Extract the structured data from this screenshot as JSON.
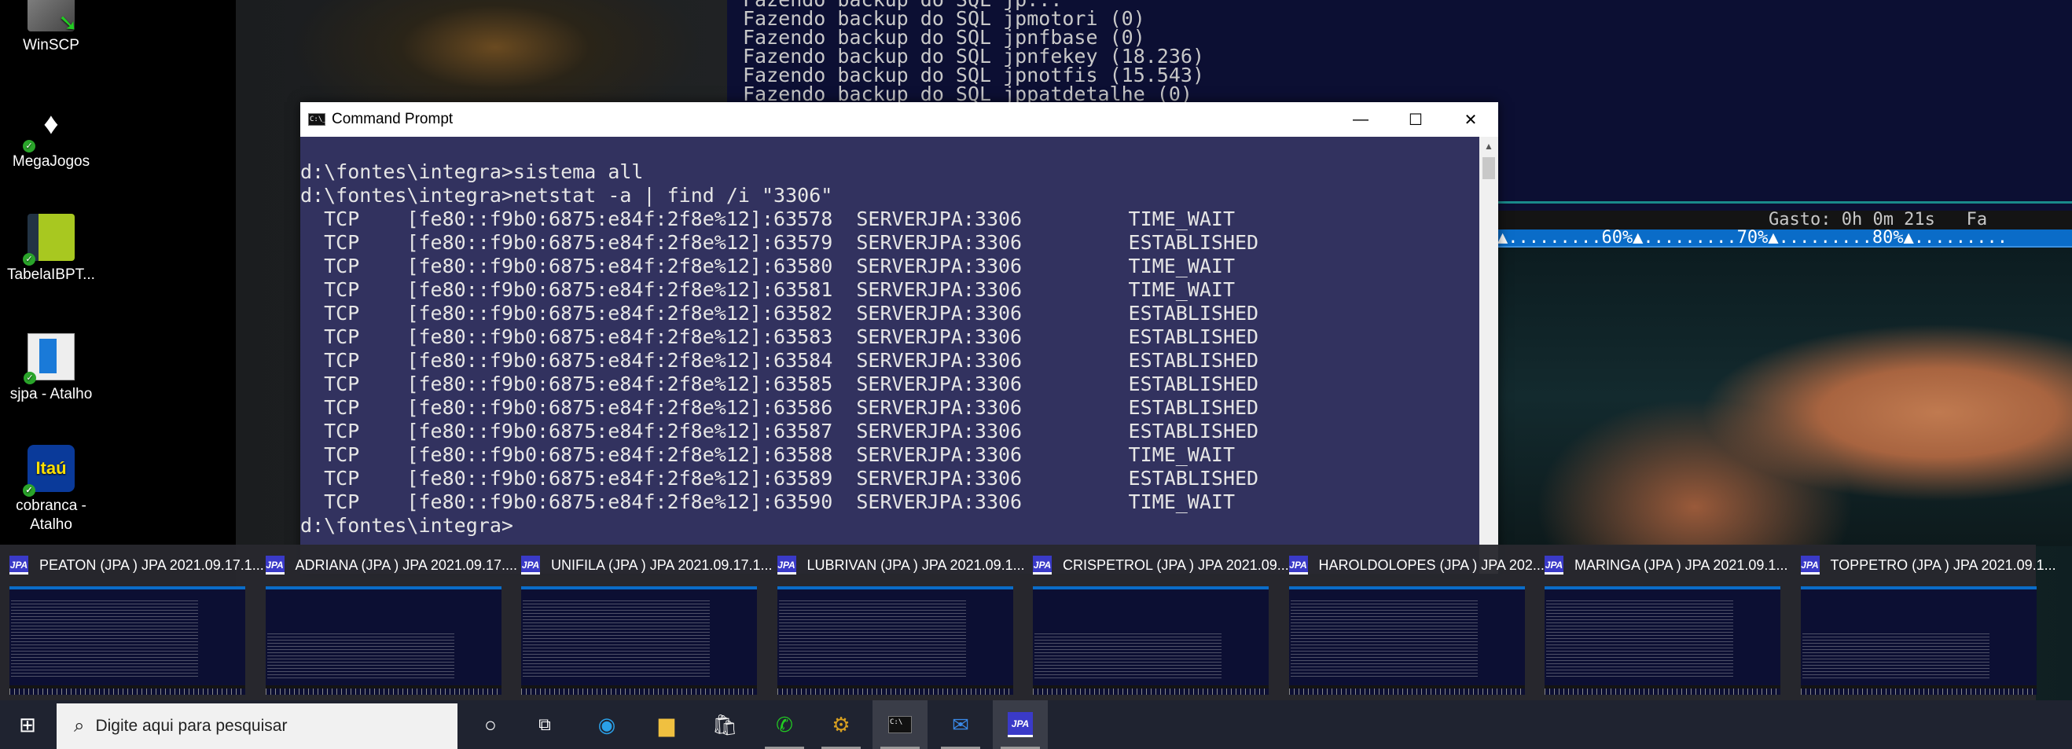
{
  "desktop": {
    "icons": [
      {
        "label": "WinSCP",
        "icon": "winscp-icon"
      },
      {
        "label": "MegaJogos",
        "icon": "megajogos-icon"
      },
      {
        "label": "TabelaIBPT...",
        "icon": "spreadsheet-icon"
      },
      {
        "label": "sjpa - Atalho",
        "icon": "shortcut-window-icon"
      },
      {
        "label": "cobranca - Atalho",
        "icon": "itau-icon",
        "icon_text": "Itaú"
      }
    ]
  },
  "background_console": {
    "lines": [
      "Fazendo backup do SQL jpmotori (0)",
      "Fazendo backup do SQL jpnfbase (0)",
      "Fazendo backup do SQL jpnfekey (18.236)",
      "Fazendo backup do SQL jpnotfis (15.543)",
      "Fazendo backup do SQL jppatdetalhe (0)"
    ],
    "status": "Gasto: 0h 0m 21s   Fa",
    "progress_scale": "▲.........60%▲.........70%▲.........80%▲.........",
    "progress_percent": 50
  },
  "cmd": {
    "title": "Command Prompt",
    "prompt_lines": [
      "d:\\fontes\\integra>sistema all",
      "d:\\fontes\\integra>netstat -a | find /i \"3306\""
    ],
    "rows": [
      {
        "proto": "TCP",
        "local": "[fe80::f9b0:6875:e84f:2f8e%12]:63578",
        "foreign": "SERVERJPA:3306",
        "state": "TIME_WAIT"
      },
      {
        "proto": "TCP",
        "local": "[fe80::f9b0:6875:e84f:2f8e%12]:63579",
        "foreign": "SERVERJPA:3306",
        "state": "ESTABLISHED"
      },
      {
        "proto": "TCP",
        "local": "[fe80::f9b0:6875:e84f:2f8e%12]:63580",
        "foreign": "SERVERJPA:3306",
        "state": "TIME_WAIT"
      },
      {
        "proto": "TCP",
        "local": "[fe80::f9b0:6875:e84f:2f8e%12]:63581",
        "foreign": "SERVERJPA:3306",
        "state": "TIME_WAIT"
      },
      {
        "proto": "TCP",
        "local": "[fe80::f9b0:6875:e84f:2f8e%12]:63582",
        "foreign": "SERVERJPA:3306",
        "state": "ESTABLISHED"
      },
      {
        "proto": "TCP",
        "local": "[fe80::f9b0:6875:e84f:2f8e%12]:63583",
        "foreign": "SERVERJPA:3306",
        "state": "ESTABLISHED"
      },
      {
        "proto": "TCP",
        "local": "[fe80::f9b0:6875:e84f:2f8e%12]:63584",
        "foreign": "SERVERJPA:3306",
        "state": "ESTABLISHED"
      },
      {
        "proto": "TCP",
        "local": "[fe80::f9b0:6875:e84f:2f8e%12]:63585",
        "foreign": "SERVERJPA:3306",
        "state": "ESTABLISHED"
      },
      {
        "proto": "TCP",
        "local": "[fe80::f9b0:6875:e84f:2f8e%12]:63586",
        "foreign": "SERVERJPA:3306",
        "state": "ESTABLISHED"
      },
      {
        "proto": "TCP",
        "local": "[fe80::f9b0:6875:e84f:2f8e%12]:63587",
        "foreign": "SERVERJPA:3306",
        "state": "ESTABLISHED"
      },
      {
        "proto": "TCP",
        "local": "[fe80::f9b0:6875:e84f:2f8e%12]:63588",
        "foreign": "SERVERJPA:3306",
        "state": "TIME_WAIT"
      },
      {
        "proto": "TCP",
        "local": "[fe80::f9b0:6875:e84f:2f8e%12]:63589",
        "foreign": "SERVERJPA:3306",
        "state": "ESTABLISHED"
      },
      {
        "proto": "TCP",
        "local": "[fe80::f9b0:6875:e84f:2f8e%12]:63590",
        "foreign": "SERVERJPA:3306",
        "state": "TIME_WAIT"
      }
    ],
    "last_prompt": "d:\\fontes\\integra>"
  },
  "thumbnails": [
    {
      "title": "PEATON (JPA ) JPA 2021.09.17.1..."
    },
    {
      "title": "ADRIANA (JPA ) JPA 2021.09.17...."
    },
    {
      "title": "UNIFILA (JPA ) JPA 2021.09.17.1..."
    },
    {
      "title": "LUBRIVAN (JPA ) JPA 2021.09.1..."
    },
    {
      "title": "CRISPETROL (JPA ) JPA 2021.09...."
    },
    {
      "title": "HAROLDOLOPES (JPA ) JPA 202..."
    },
    {
      "title": "MARINGA (JPA ) JPA 2021.09.1..."
    },
    {
      "title": "TOPPETRO (JPA ) JPA 2021.09.1..."
    }
  ],
  "app_icon_text": "JPA",
  "taskbar": {
    "search_placeholder": "Digite aqui para pesquisar",
    "apps": [
      "cortana-icon",
      "task-view-icon",
      "edge-icon",
      "file-explorer-icon",
      "store-icon",
      "whatsapp-icon",
      "app-icon",
      "command-prompt-icon",
      "thunderbird-icon",
      "jpa-icon"
    ]
  },
  "colors": {
    "console_bg": "#32325f",
    "top_console_bg": "#0c0f33",
    "progress": "#0a6cc8"
  }
}
